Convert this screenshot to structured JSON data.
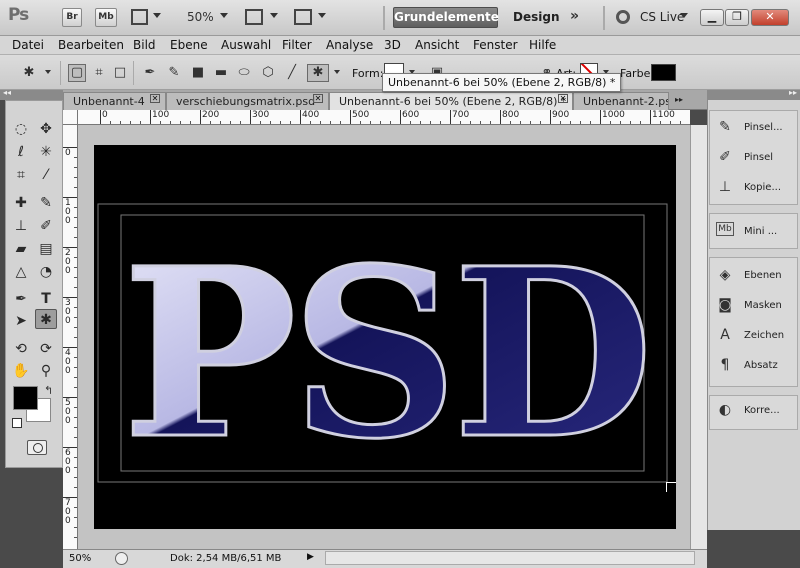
{
  "appbar": {
    "logo": "Ps",
    "btn_br": "Br",
    "btn_mb": "Mb",
    "zoom": "50%",
    "workspace_active": "Grundelemente",
    "workspace_design": "Design",
    "more": "»",
    "cslive": "CS Live"
  },
  "menu": [
    "Datei",
    "Bearbeiten",
    "Bild",
    "Ebene",
    "Auswahl",
    "Filter",
    "Analyse",
    "3D",
    "Ansicht",
    "Fenster",
    "Hilfe"
  ],
  "options": {
    "form_label": "Form:",
    "art_label": "Art:",
    "farbe_label": "Farbe:",
    "tooltip": "Unbenannt-6 bei 50% (Ebene 2, RGB/8) *"
  },
  "tabs": [
    {
      "label": "Unbenannt-4"
    },
    {
      "label": "verschiebungsmatrix.psd"
    },
    {
      "label": "Unbenannt-6 bei 50% (Ebene 2, RGB/8) *"
    },
    {
      "label": "Unbenannt-2.ps"
    }
  ],
  "ruler": {
    "h": [
      "0",
      "100",
      "200",
      "300",
      "400",
      "500",
      "600",
      "700",
      "800",
      "900",
      "1000",
      "1100"
    ],
    "v": [
      "0",
      "1\n0\n0",
      "2\n0\n0",
      "3\n0\n0",
      "4\n0\n0",
      "5\n0\n0",
      "6\n0\n0",
      "7\n0\n0"
    ]
  },
  "canvas_text": "PSD",
  "status": {
    "zoom": "50%",
    "doc": "Dok: 2,54 MB/6,51 MB"
  },
  "panels": [
    {
      "label": "Pinsel...",
      "icon": "brush-presets-icon"
    },
    {
      "label": "Pinsel",
      "icon": "brush-icon"
    },
    {
      "label": "Kopie...",
      "icon": "clone-source-icon"
    },
    {
      "label": "Mini ...",
      "icon": "mini-bridge-icon"
    },
    {
      "label": "Ebenen",
      "icon": "layers-icon"
    },
    {
      "label": "Masken",
      "icon": "masks-icon"
    },
    {
      "label": "Zeichen",
      "icon": "character-icon"
    },
    {
      "label": "Absatz",
      "icon": "paragraph-icon"
    },
    {
      "label": "Korre...",
      "icon": "adjustments-icon"
    }
  ],
  "colors": {
    "chrome": "#d6d6d6",
    "foreground": "#000000",
    "background": "#ffffff",
    "letter_fill": "#14145a",
    "canvas": "#000000"
  }
}
